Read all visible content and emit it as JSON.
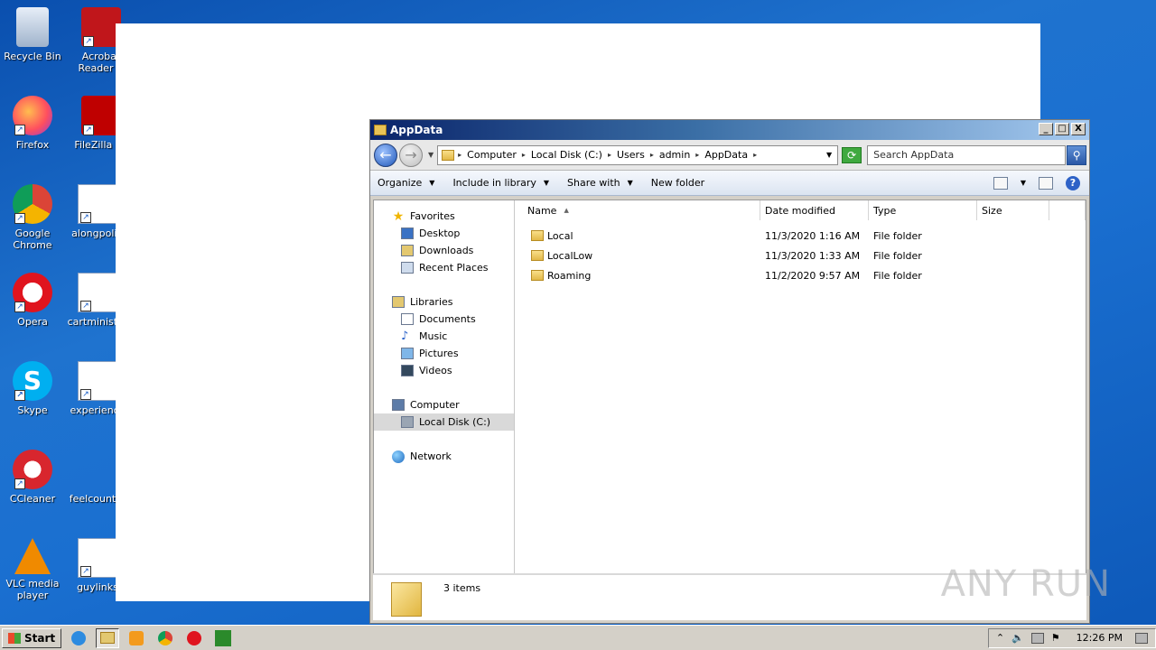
{
  "desktop_icons": [
    {
      "label": "Recycle Bin",
      "icon": "recycle-bin-icon"
    },
    {
      "label": "Acrobat Reader D",
      "icon": "acrobat-reader-icon"
    },
    {
      "label": "Firefox",
      "icon": "firefox-icon"
    },
    {
      "label": "FileZilla Cli",
      "icon": "filezilla-icon"
    },
    {
      "label": "Google Chrome",
      "icon": "chrome-icon"
    },
    {
      "label": "alongpoliti",
      "icon": "word-doc-icon"
    },
    {
      "label": "Opera",
      "icon": "opera-icon"
    },
    {
      "label": "cartminister",
      "icon": "word-doc-icon"
    },
    {
      "label": "Skype",
      "icon": "skype-icon"
    },
    {
      "label": "experience",
      "icon": "word-doc-icon"
    },
    {
      "label": "CCleaner",
      "icon": "ccleaner-icon"
    },
    {
      "label": "feelcountry",
      "icon": "word-doc-icon"
    },
    {
      "label": "VLC media player",
      "icon": "vlc-icon"
    },
    {
      "label": "guylinks",
      "icon": "word-doc-icon"
    }
  ],
  "window": {
    "title": "AppData",
    "controls": {
      "minimize": "_",
      "maximize": "□",
      "close": "X"
    }
  },
  "address": {
    "crumbs": [
      "Computer",
      "Local Disk (C:)",
      "Users",
      "admin",
      "AppData"
    ]
  },
  "search": {
    "placeholder": "Search AppData"
  },
  "toolbar": {
    "organize": "Organize",
    "include_in_library": "Include in library",
    "share_with": "Share with",
    "new_folder": "New folder"
  },
  "nav": {
    "favorites": "Favorites",
    "desktop": "Desktop",
    "downloads": "Downloads",
    "recent_places": "Recent Places",
    "libraries": "Libraries",
    "documents": "Documents",
    "music": "Music",
    "pictures": "Pictures",
    "videos": "Videos",
    "computer": "Computer",
    "local_disk": "Local Disk (C:)",
    "network": "Network"
  },
  "columns": {
    "name": "Name",
    "date": "Date modified",
    "type": "Type",
    "size": "Size"
  },
  "files": [
    {
      "name": "Local",
      "date": "11/3/2020 1:16 AM",
      "type": "File folder"
    },
    {
      "name": "LocalLow",
      "date": "11/3/2020 1:33 AM",
      "type": "File folder"
    },
    {
      "name": "Roaming",
      "date": "11/2/2020 9:57 AM",
      "type": "File folder"
    }
  ],
  "status": {
    "items": "3 items"
  },
  "taskbar": {
    "start": "Start",
    "clock": "12:26 PM"
  },
  "watermark": "ANY RUN"
}
